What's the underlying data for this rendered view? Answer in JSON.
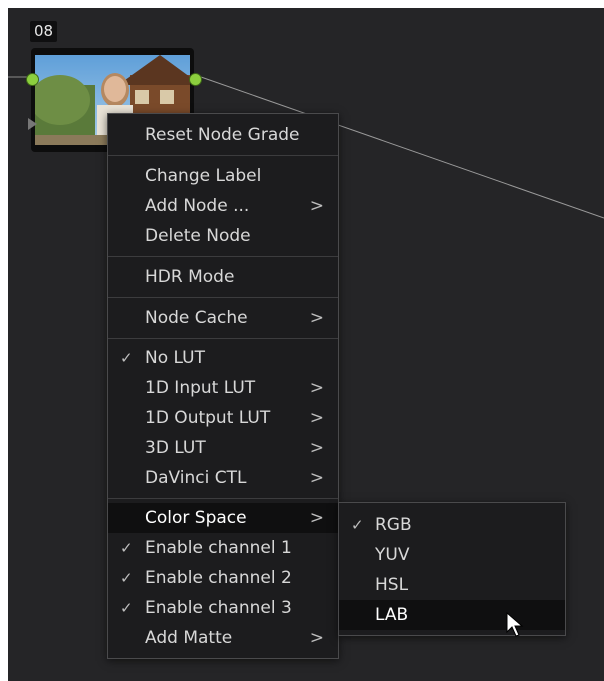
{
  "node": {
    "label": "08"
  },
  "context_menu": {
    "items": [
      {
        "label": "Reset Node Grade"
      },
      {
        "label": "Change Label"
      },
      {
        "label": "Add Node ...",
        "arrow": ">"
      },
      {
        "label": "Delete Node"
      },
      {
        "label": "HDR Mode"
      },
      {
        "label": "Node Cache",
        "arrow": ">"
      },
      {
        "label": "No LUT",
        "check": "✓"
      },
      {
        "label": "1D Input LUT",
        "arrow": ">"
      },
      {
        "label": "1D Output LUT",
        "arrow": ">"
      },
      {
        "label": "3D LUT",
        "arrow": ">"
      },
      {
        "label": "DaVinci CTL",
        "arrow": ">"
      },
      {
        "label": "Color Space",
        "arrow": ">"
      },
      {
        "label": "Enable channel 1",
        "check": "✓"
      },
      {
        "label": "Enable channel 2",
        "check": "✓"
      },
      {
        "label": "Enable channel 3",
        "check": "✓"
      },
      {
        "label": "Add Matte",
        "arrow": ">"
      }
    ]
  },
  "color_space_submenu": {
    "items": [
      {
        "label": "RGB",
        "check": "✓"
      },
      {
        "label": "YUV"
      },
      {
        "label": "HSL"
      },
      {
        "label": "LAB"
      }
    ]
  },
  "colors": {
    "canvas": "#252527",
    "menu": "#1c1c1e",
    "highlight": "#0f0f10",
    "port": "#8ccf3e"
  }
}
